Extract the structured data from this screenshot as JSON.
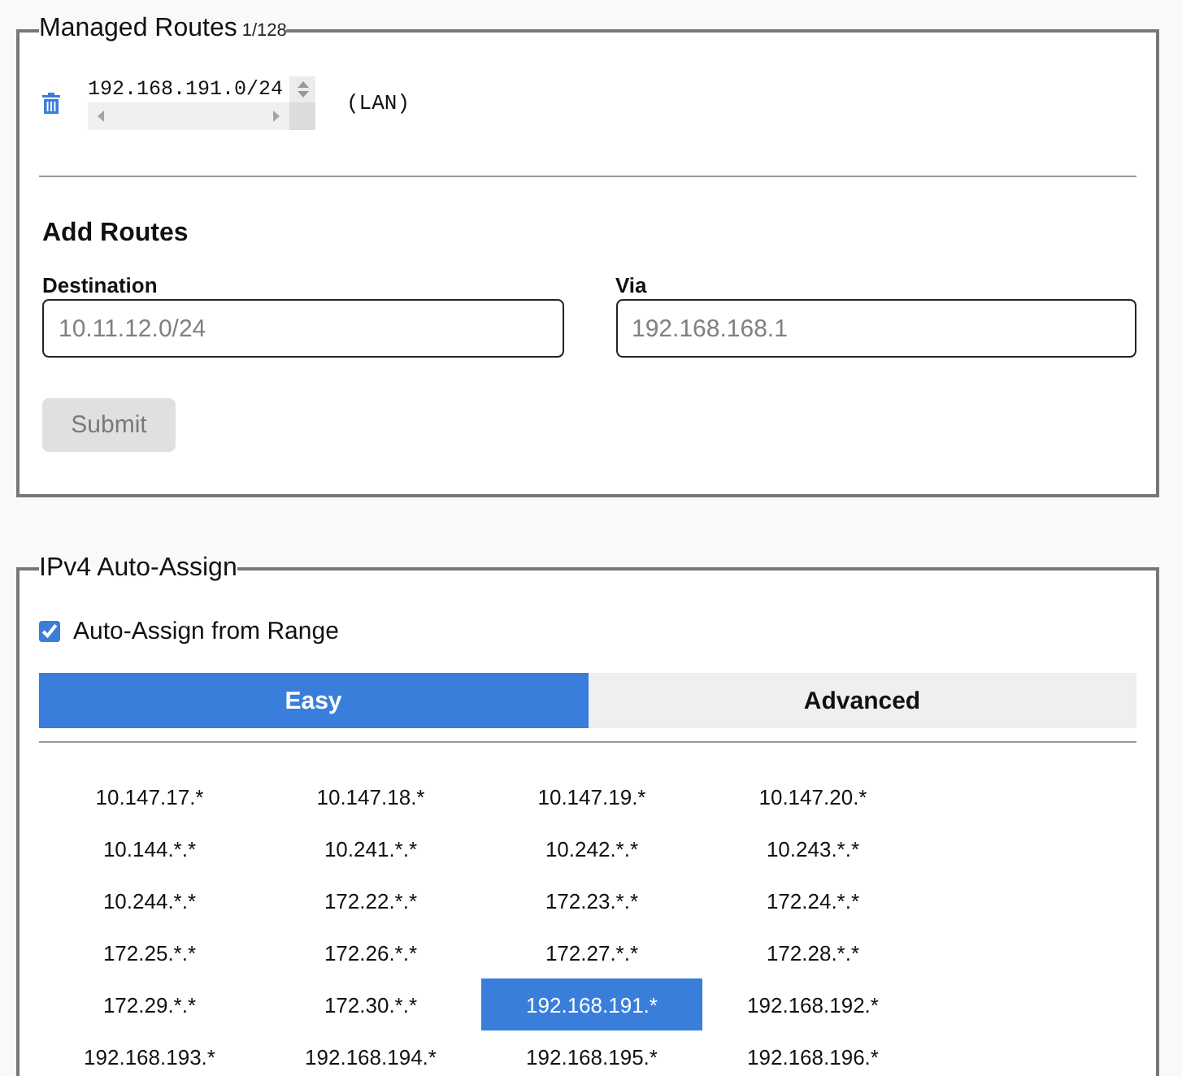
{
  "managed_routes": {
    "legend": "Managed Routes",
    "count": "1/128",
    "routes": [
      {
        "network": "192.168.191.0/24",
        "note": "(LAN)"
      }
    ],
    "add_routes": {
      "heading": "Add Routes",
      "fields": [
        {
          "label": "Destination",
          "placeholder": "10.11.12.0/24"
        },
        {
          "label": "Via",
          "placeholder": "192.168.168.1"
        }
      ],
      "submit": {
        "label": "Submit",
        "disabled": true
      }
    }
  },
  "ipv4_auto_assign": {
    "legend": "IPv4 Auto-Assign",
    "auto_assign": {
      "label": "Auto-Assign from Range",
      "checked": true
    },
    "tabs": [
      {
        "label": "Easy",
        "selected": true
      },
      {
        "label": "Advanced",
        "selected": false
      }
    ],
    "ranges": [
      {
        "label": "10.147.17.*",
        "selected": false
      },
      {
        "label": "10.147.18.*",
        "selected": false
      },
      {
        "label": "10.147.19.*",
        "selected": false
      },
      {
        "label": "10.147.20.*",
        "selected": false
      },
      {
        "label": "10.144.*.*",
        "selected": false
      },
      {
        "label": "10.241.*.*",
        "selected": false
      },
      {
        "label": "10.242.*.*",
        "selected": false
      },
      {
        "label": "10.243.*.*",
        "selected": false
      },
      {
        "label": "10.244.*.*",
        "selected": false
      },
      {
        "label": "172.22.*.*",
        "selected": false
      },
      {
        "label": "172.23.*.*",
        "selected": false
      },
      {
        "label": "172.24.*.*",
        "selected": false
      },
      {
        "label": "172.25.*.*",
        "selected": false
      },
      {
        "label": "172.26.*.*",
        "selected": false
      },
      {
        "label": "172.27.*.*",
        "selected": false
      },
      {
        "label": "172.28.*.*",
        "selected": false
      },
      {
        "label": "172.29.*.*",
        "selected": false
      },
      {
        "label": "172.30.*.*",
        "selected": false
      },
      {
        "label": "192.168.191.*",
        "selected": true
      },
      {
        "label": "192.168.192.*",
        "selected": false
      },
      {
        "label": "192.168.193.*",
        "selected": false
      },
      {
        "label": "192.168.194.*",
        "selected": false
      },
      {
        "label": "192.168.195.*",
        "selected": false
      },
      {
        "label": "192.168.196.*",
        "selected": false
      }
    ]
  }
}
